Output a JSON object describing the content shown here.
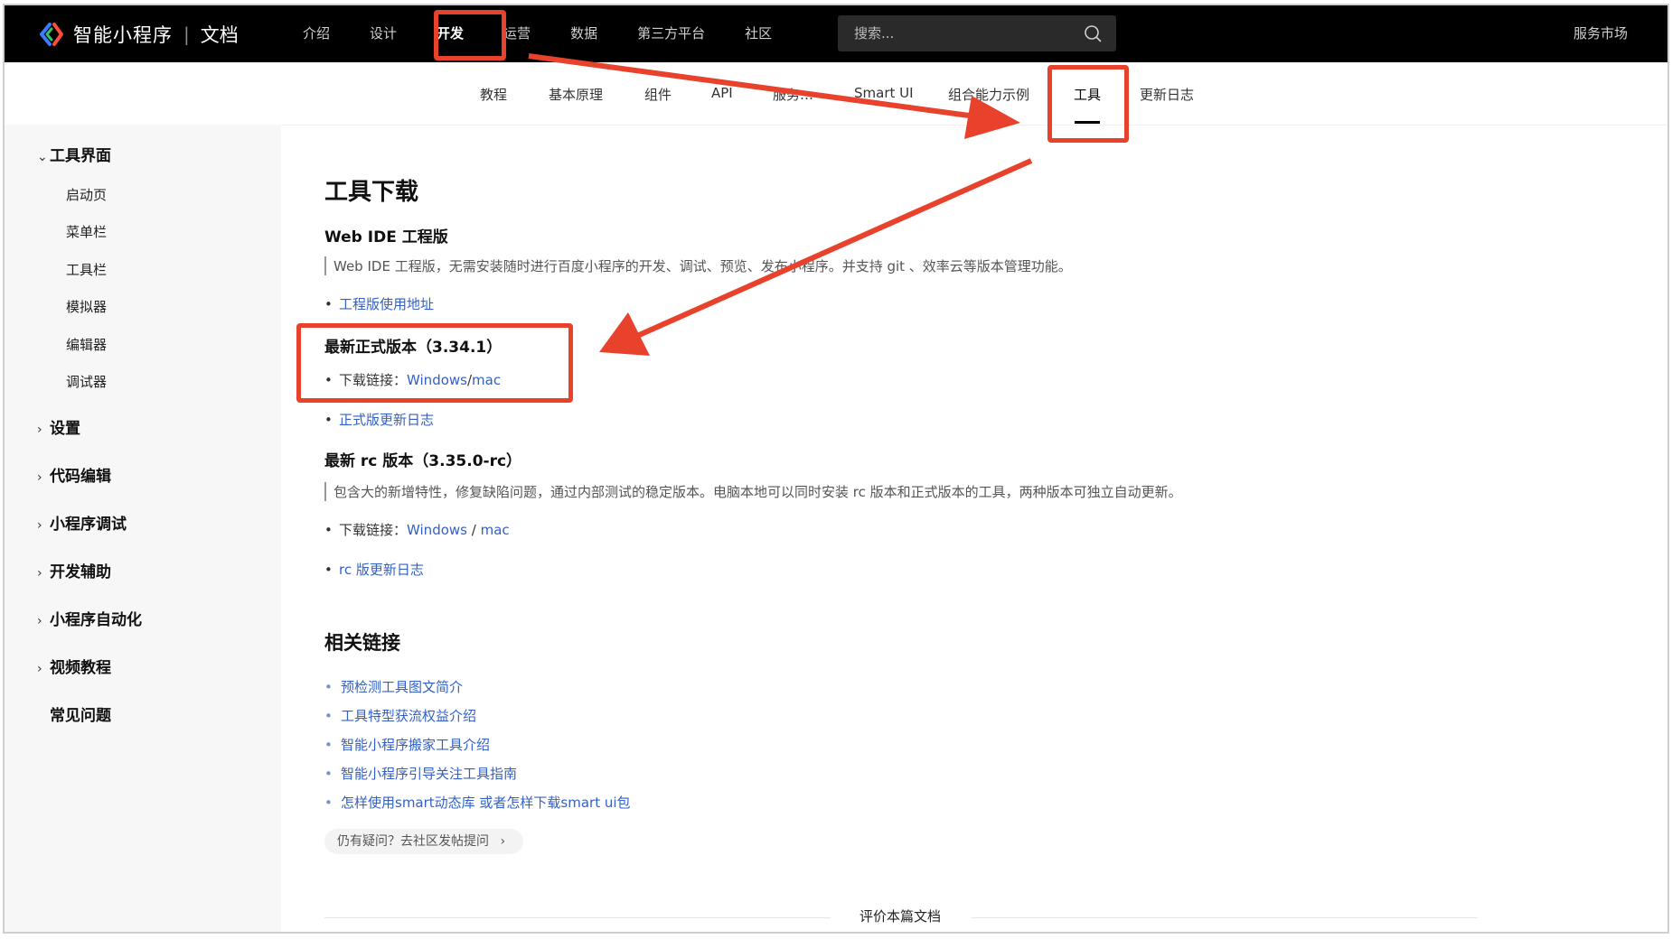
{
  "app": {
    "logo_text": "智能小程序",
    "logo_separator": "|",
    "logo_sub": "文档",
    "service_market": "服务市场"
  },
  "topnav": {
    "items": [
      "介绍",
      "设计",
      "开发",
      "运营",
      "数据",
      "第三方平台",
      "社区"
    ],
    "active": "开发"
  },
  "search": {
    "placeholder": "搜索..."
  },
  "subnav": {
    "items": [
      "教程",
      "基本原理",
      "组件",
      "API",
      "服务…",
      "Smart UI",
      "组合能力示例",
      "工具",
      "更新日志"
    ],
    "active": "工具"
  },
  "sidebar": {
    "groups": [
      {
        "label": "工具界面",
        "expanded": true,
        "items": [
          "启动页",
          "菜单栏",
          "工具栏",
          "模拟器",
          "编辑器",
          "调试器"
        ]
      },
      {
        "label": "设置"
      },
      {
        "label": "代码编辑"
      },
      {
        "label": "小程序调试"
      },
      {
        "label": "开发辅助"
      },
      {
        "label": "小程序自动化"
      },
      {
        "label": "视频教程"
      },
      {
        "label": "常见问题"
      }
    ]
  },
  "content": {
    "title": "工具下载",
    "web_ide": {
      "heading": "Web IDE 工程版",
      "desc": "Web IDE 工程版，无需安装随时进行百度小程序的开发、调试、预览、发布小程序。并支持 git 、效率云等版本管理功能。",
      "link": "工程版使用地址"
    },
    "stable": {
      "heading": "最新正式版本（3.34.1）",
      "download_label": "下载链接：",
      "windows": "Windows",
      "slash": "/",
      "mac": "mac",
      "changelog": "正式版更新日志"
    },
    "rc": {
      "heading": "最新 rc 版本（3.35.0-rc）",
      "desc": "包含大的新增特性，修复缺陷问题，通过内部测试的稳定版本。电脑本地可以同时安装 rc 版本和正式版本的工具，两种版本可独立自动更新。",
      "download_label": "下载链接：",
      "windows": "Windows",
      "slash": " / ",
      "mac": "mac",
      "changelog": "rc 版更新日志"
    },
    "related": {
      "heading": "相关链接",
      "links": [
        "预检测工具图文简介",
        "工具特型获流权益介绍",
        "智能小程序搬家工具介绍",
        "智能小程序引导关注工具指南",
        "怎样使用smart动态库 或者怎样下载smart ui包"
      ]
    },
    "ask_button": "仍有疑问？去社区发帖提问",
    "ask_chevron": "›",
    "rate": "评价本篇文档"
  },
  "colors": {
    "topbar_bg": "#000000",
    "link": "#3360c4",
    "annotation_red": "#e8412c",
    "sidebar_bg": "#f7f7f7"
  },
  "icons": {
    "logo": "swan-logo-icon",
    "search": "search-icon",
    "chevron_down": "chevron-down-icon",
    "chevron_right": "chevron-right-icon"
  }
}
